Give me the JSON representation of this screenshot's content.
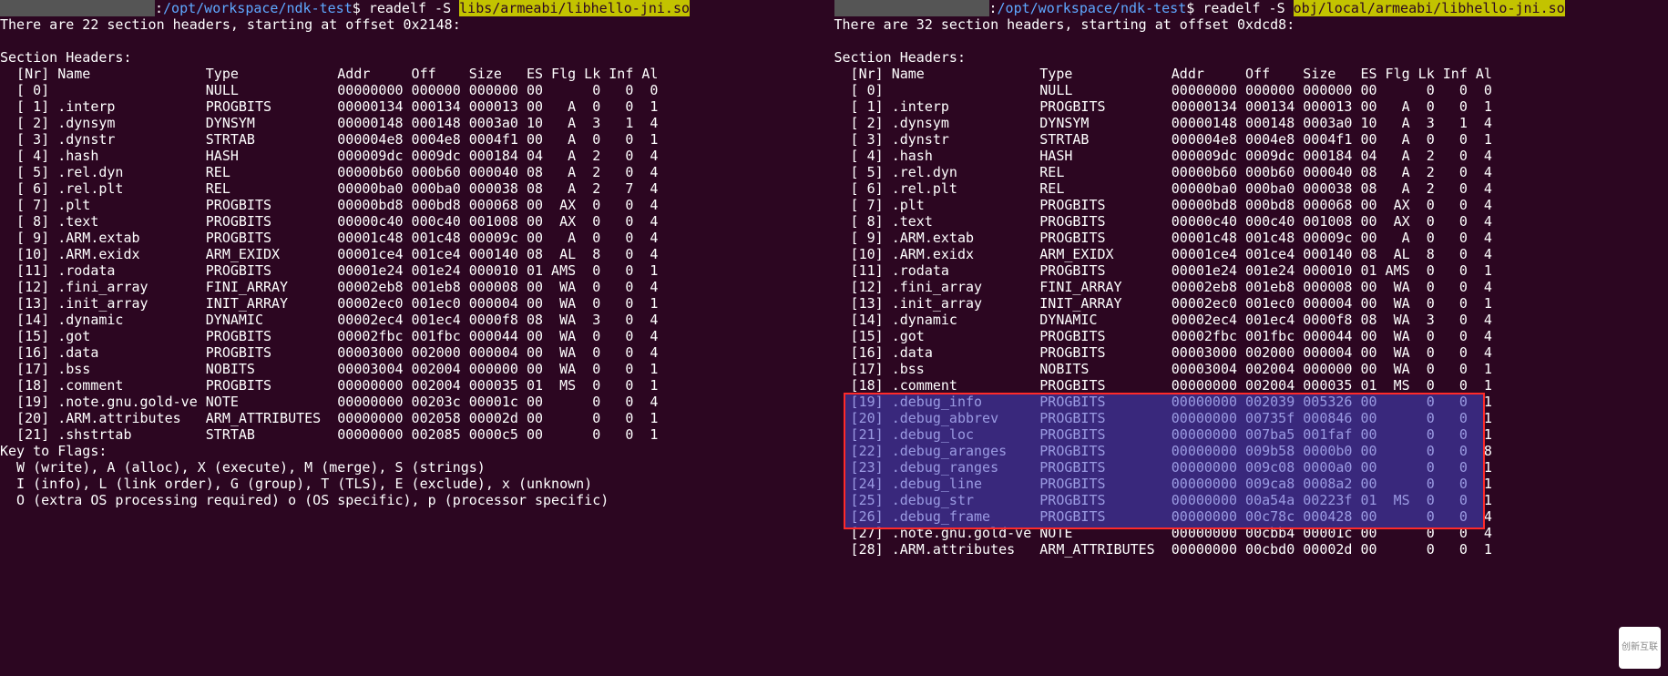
{
  "left": {
    "prompt_path": "/opt/workspace/ndk-test",
    "cmd": "readelf -S ",
    "cmd_hl": "libs/armeabi/libhello-jni.so",
    "summary": "There are 22 section headers, starting at offset 0x2148:",
    "blank": "",
    "sh_title": "Section Headers:",
    "header_row": "  [Nr] Name              Type            Addr     Off    Size   ES Flg Lk Inf Al",
    "sections": [
      "  [ 0]                   NULL            00000000 000000 000000 00      0   0  0",
      "  [ 1] .interp           PROGBITS        00000134 000134 000013 00   A  0   0  1",
      "  [ 2] .dynsym           DYNSYM          00000148 000148 0003a0 10   A  3   1  4",
      "  [ 3] .dynstr           STRTAB          000004e8 0004e8 0004f1 00   A  0   0  1",
      "  [ 4] .hash             HASH            000009dc 0009dc 000184 04   A  2   0  4",
      "  [ 5] .rel.dyn          REL             00000b60 000b60 000040 08   A  2   0  4",
      "  [ 6] .rel.plt          REL             00000ba0 000ba0 000038 08   A  2   7  4",
      "  [ 7] .plt              PROGBITS        00000bd8 000bd8 000068 00  AX  0   0  4",
      "  [ 8] .text             PROGBITS        00000c40 000c40 001008 00  AX  0   0  4",
      "  [ 9] .ARM.extab        PROGBITS        00001c48 001c48 00009c 00   A  0   0  4",
      "  [10] .ARM.exidx        ARM_EXIDX       00001ce4 001ce4 000140 08  AL  8   0  4",
      "  [11] .rodata           PROGBITS        00001e24 001e24 000010 01 AMS  0   0  1",
      "  [12] .fini_array       FINI_ARRAY      00002eb8 001eb8 000008 00  WA  0   0  4",
      "  [13] .init_array       INIT_ARRAY      00002ec0 001ec0 000004 00  WA  0   0  1",
      "  [14] .dynamic          DYNAMIC         00002ec4 001ec4 0000f8 08  WA  3   0  4",
      "  [15] .got              PROGBITS        00002fbc 001fbc 000044 00  WA  0   0  4",
      "  [16] .data             PROGBITS        00003000 002000 000004 00  WA  0   0  4",
      "  [17] .bss              NOBITS          00003004 002004 000000 00  WA  0   0  1",
      "  [18] .comment          PROGBITS        00000000 002004 000035 01  MS  0   0  1",
      "  [19] .note.gnu.gold-ve NOTE            00000000 00203c 00001c 00      0   0  4",
      "  [20] .ARM.attributes   ARM_ATTRIBUTES  00000000 002058 00002d 00      0   0  1",
      "  [21] .shstrtab         STRTAB          00000000 002085 0000c5 00      0   0  1"
    ],
    "key_title": "Key to Flags:",
    "key_lines": [
      "  W (write), A (alloc), X (execute), M (merge), S (strings)",
      "  I (info), L (link order), G (group), T (TLS), E (exclude), x (unknown)",
      "  O (extra OS processing required) o (OS specific), p (processor specific)"
    ]
  },
  "right": {
    "prompt_path": "/opt/workspace/ndk-test",
    "cmd": "readelf -S ",
    "cmd_hl": "obj/local/armeabi/libhello-jni.so",
    "summary": "There are 32 section headers, starting at offset 0xdcd8:",
    "blank": "",
    "sh_title": "Section Headers:",
    "header_row": "  [Nr] Name              Type            Addr     Off    Size   ES Flg Lk Inf Al",
    "sections": [
      "  [ 0]                   NULL            00000000 000000 000000 00      0   0  0",
      "  [ 1] .interp           PROGBITS        00000134 000134 000013 00   A  0   0  1",
      "  [ 2] .dynsym           DYNSYM          00000148 000148 0003a0 10   A  3   1  4",
      "  [ 3] .dynstr           STRTAB          000004e8 0004e8 0004f1 00   A  0   0  1",
      "  [ 4] .hash             HASH            000009dc 0009dc 000184 04   A  2   0  4",
      "  [ 5] .rel.dyn          REL             00000b60 000b60 000040 08   A  2   0  4",
      "  [ 6] .rel.plt          REL             00000ba0 000ba0 000038 08   A  2   0  4",
      "  [ 7] .plt              PROGBITS        00000bd8 000bd8 000068 00  AX  0   0  4",
      "  [ 8] .text             PROGBITS        00000c40 000c40 001008 00  AX  0   0  4",
      "  [ 9] .ARM.extab        PROGBITS        00001c48 001c48 00009c 00   A  0   0  4",
      "  [10] .ARM.exidx        ARM_EXIDX       00001ce4 001ce4 000140 08  AL  8   0  4",
      "  [11] .rodata           PROGBITS        00001e24 001e24 000010 01 AMS  0   0  1",
      "  [12] .fini_array       FINI_ARRAY      00002eb8 001eb8 000008 00  WA  0   0  4",
      "  [13] .init_array       INIT_ARRAY      00002ec0 001ec0 000004 00  WA  0   0  1",
      "  [14] .dynamic          DYNAMIC         00002ec4 001ec4 0000f8 08  WA  3   0  4",
      "  [15] .got              PROGBITS        00002fbc 001fbc 000044 00  WA  0   0  4",
      "  [16] .data             PROGBITS        00003000 002000 000004 00  WA  0   0  4",
      "  [17] .bss              NOBITS          00003004 002004 000000 00  WA  0   0  1",
      "  [18] .comment          PROGBITS        00000000 002004 000035 01  MS  0   0  1",
      "  [19] .debug_info       PROGBITS        00000000 002039 005326 00      0   0  1",
      "  [20] .debug_abbrev     PROGBITS        00000000 00735f 000846 00      0   0  1",
      "  [21] .debug_loc        PROGBITS        00000000 007ba5 001faf 00      0   0  1",
      "  [22] .debug_aranges    PROGBITS        00000000 009b58 0000b0 00      0   0  8",
      "  [23] .debug_ranges     PROGBITS        00000000 009c08 0000a0 00      0   0  1",
      "  [24] .debug_line       PROGBITS        00000000 009ca8 0008a2 00      0   0  1",
      "  [25] .debug_str        PROGBITS        00000000 00a54a 00223f 01  MS  0   0  1",
      "  [26] .debug_frame      PROGBITS        00000000 00c78c 000428 00      0   0  4",
      "  [27] .note.gnu.gold-ve NOTE            00000000 00cbb4 00001c 00      0   0  4",
      "  [28] .ARM.attributes   ARM_ATTRIBUTES  00000000 00cbd0 00002d 00      0   0  1"
    ],
    "highlight_first_idx": 19,
    "highlight_last_idx": 26
  },
  "watermark": "创新互联"
}
